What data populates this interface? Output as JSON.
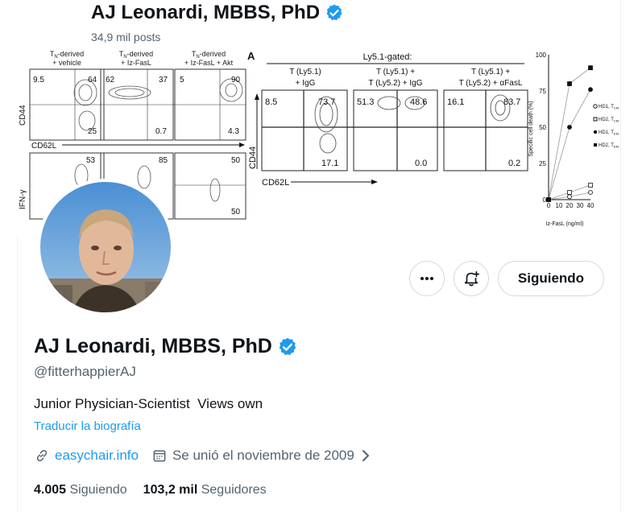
{
  "header": {
    "name": "AJ Leonardi, MBBS, PhD",
    "posts_count": "34,9 mil posts"
  },
  "banner": {
    "flow_col_labels": [
      [
        "T",
        "N",
        "-derived",
        "+ vehicle"
      ],
      [
        "T",
        "N",
        "-derived",
        "+ Iz-FasL"
      ],
      [
        "T",
        "N",
        "-derived",
        "+ Iz-FasL + Akt"
      ]
    ],
    "flow_row1_values": [
      {
        "tl": "9.5",
        "tr": "64",
        "br": "25"
      },
      {
        "tl": "62",
        "tr": "37",
        "br": "0.7"
      },
      {
        "tl": "5",
        "tr": "90",
        "br": "4.3"
      }
    ],
    "flow_row2_values": [
      {
        "tr": "53"
      },
      {
        "tr": "85"
      },
      {
        "tr": "50",
        "br": "50"
      }
    ],
    "axis_cd44": "CD44",
    "axis_cd62l": "CD62L",
    "axis_ifn": "IFN-γ",
    "panel_letter": "A",
    "gated_title": "Ly5.1-gated:",
    "gated_col_labels": [
      {
        "line1": "T (Ly5.1)",
        "sub": "N",
        "line2": "+ IgG"
      },
      {
        "line1": "T (Ly5.1) +",
        "sub": "N",
        "line2": "T (Ly5.2) + IgG",
        "sub2": "Mem"
      },
      {
        "line1": "T (Ly5.1) +",
        "sub": "N",
        "line2": "T (Ly5.2) + αFasL",
        "sub2": "Mem"
      }
    ],
    "gated_values": [
      {
        "tl": "8.5",
        "tr": "73.7",
        "br": "17.1"
      },
      {
        "tl": "51.3",
        "tr": "48.6",
        "br": "0.0"
      },
      {
        "tl": "16.1",
        "tr": "83.7",
        "br": "0.2"
      }
    ],
    "chart_y_ticks": [
      "100",
      "75",
      "50",
      "25",
      "0"
    ],
    "chart_ylabel": "Specific cell death (%)",
    "chart_x_ticks": [
      "0",
      "10",
      "20",
      "30",
      "40"
    ],
    "chart_xlabel": "Iz-FasL (ng/ml)",
    "chart_legend": [
      "HD1, T",
      "HD2, T",
      "HD1, T",
      "HD2, T"
    ],
    "chart_legend_subs": [
      "CM",
      "CM",
      "EM",
      "EM"
    ]
  },
  "chart_data": {
    "type": "line",
    "x": [
      0,
      20,
      40
    ],
    "ylim": [
      0,
      100
    ],
    "xlabel": "Iz-FasL (ng/ml)",
    "ylabel": "Specific cell death (%)",
    "series": [
      {
        "name": "HD1, T CM",
        "values": [
          0,
          2,
          5
        ]
      },
      {
        "name": "HD2, T CM",
        "values": [
          0,
          5,
          10
        ]
      },
      {
        "name": "HD1, T EM",
        "values": [
          0,
          50,
          76
        ]
      },
      {
        "name": "HD2, T EM",
        "values": [
          0,
          80,
          91
        ]
      }
    ]
  },
  "profile": {
    "name": "AJ Leonardi, MBBS, PhD",
    "handle": "@fitterhappierAJ",
    "bio": "Junior Physician-Scientist  Views own",
    "translate_label": "Traducir la biografía",
    "website": "easychair.info",
    "joined": "Se unió el noviembre de 2009",
    "following_count": "4.005",
    "following_label": "Siguiendo",
    "followers_count": "103,2 mil",
    "followers_label": "Seguidores"
  },
  "actions": {
    "more_icon": "more-horizontal-icon",
    "notify_icon": "bell-plus-icon",
    "following_button": "Siguiendo"
  },
  "colors": {
    "accent": "#1d9bf0",
    "verified": "#1d9bf0",
    "text_secondary": "#536471",
    "border": "#cfd9de"
  }
}
